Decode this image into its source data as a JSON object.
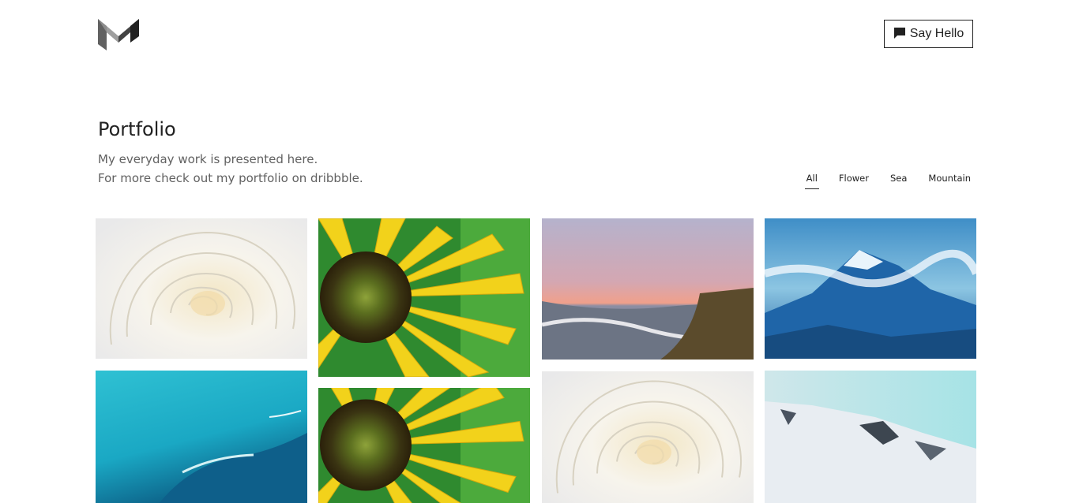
{
  "header": {
    "logo_icon": "material-m-logo-icon",
    "cta_label": "Say Hello",
    "cta_icon": "chat-bubble-icon"
  },
  "portfolio": {
    "title": "Portfolio",
    "subtitle_line1": "My everyday work is presented here.",
    "subtitle_line2": "For more check out my portfolio on dribbble."
  },
  "filters": {
    "items": [
      "All",
      "Flower",
      "Sea",
      "Mountain"
    ],
    "active": "All"
  },
  "gallery": {
    "items": [
      {
        "subject": "white-rose",
        "category": "Flower"
      },
      {
        "subject": "sunflower",
        "category": "Flower"
      },
      {
        "subject": "sea-sunset-cliff",
        "category": "Sea"
      },
      {
        "subject": "blue-mountains",
        "category": "Mountain"
      },
      {
        "subject": "turquoise-sea",
        "category": "Sea"
      },
      {
        "subject": "sunflower",
        "category": "Flower"
      },
      {
        "subject": "white-rose",
        "category": "Flower"
      },
      {
        "subject": "snowy-mountain",
        "category": "Mountain"
      }
    ]
  },
  "colors": {
    "text": "#212121",
    "muted": "#616161",
    "background": "#ffffff"
  }
}
